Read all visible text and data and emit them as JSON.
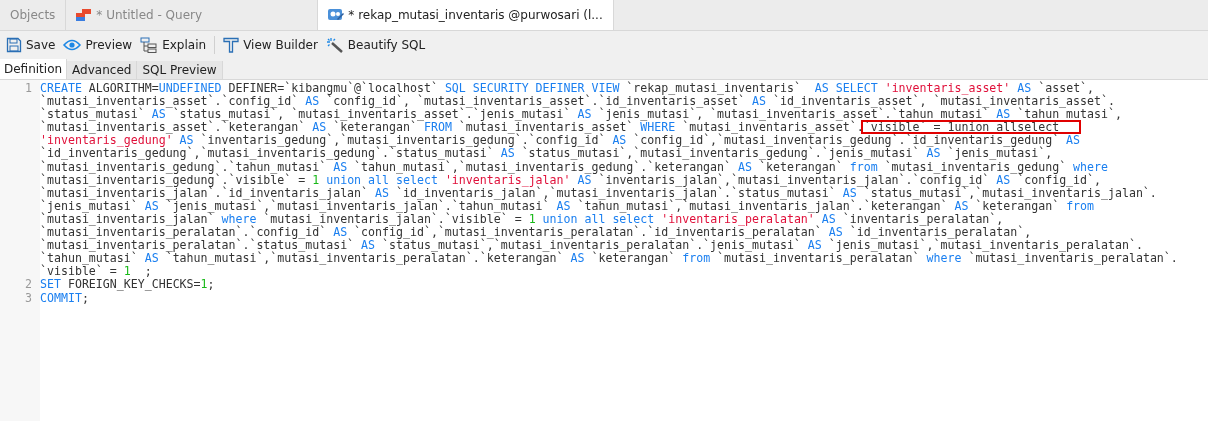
{
  "tabs": [
    {
      "label": "Objects",
      "kind": "plain",
      "selected": false
    },
    {
      "label": "* Untitled - Query",
      "kind": "query",
      "selected": false
    },
    {
      "label": "* rekap_mutasi_inventaris @purwosari (l...",
      "kind": "view",
      "selected": true
    }
  ],
  "toolbar": [
    {
      "label": "Save",
      "kind": "save"
    },
    {
      "label": "Preview",
      "kind": "preview"
    },
    {
      "label": "Explain",
      "kind": "explain",
      "separator_after": true
    },
    {
      "label": "View Builder",
      "kind": "builder"
    },
    {
      "label": "Beautify SQL",
      "kind": "beautify"
    }
  ],
  "subtabs": [
    {
      "label": "Definition",
      "selected": true
    },
    {
      "label": "Advanced",
      "selected": false
    },
    {
      "label": "SQL Preview",
      "selected": false
    }
  ],
  "editor": {
    "lines": [
      {
        "number": "1",
        "rows": [
          {
            "tokens": [
              {
                "kind": "kw",
                "text": "CREATE"
              },
              {
                "kind": "plain",
                "text": " ALGORITHM="
              },
              {
                "kind": "kw",
                "text": "UNDEFINED"
              },
              {
                "kind": "plain",
                "text": " DEFINER=`kibangmu`@`localhost` "
              },
              {
                "kind": "kw",
                "text": "SQL SECURITY DEFINER VIEW"
              },
              {
                "kind": "plain",
                "text": " `rekap_mutasi_inventaris`  "
              },
              {
                "kind": "kw",
                "text": "AS SELECT "
              },
              {
                "kind": "str",
                "text": "'inventaris_asset' "
              },
              {
                "kind": "kw",
                "text": "AS"
              },
              {
                "kind": "plain",
                "text": " `asset`,"
              }
            ]
          },
          {
            "tokens": [
              {
                "kind": "plain",
                "text": "`mutasi_inventaris_asset`.`config_id` "
              },
              {
                "kind": "kw",
                "text": "AS"
              },
              {
                "kind": "plain",
                "text": " `config_id`, `mutasi_inventaris_asset`.`id_inventaris_asset` "
              },
              {
                "kind": "kw",
                "text": "AS"
              },
              {
                "kind": "plain",
                "text": " `id_inventaris_asset`, `mutasi_inventaris_asset`."
              }
            ]
          },
          {
            "tokens": [
              {
                "kind": "plain",
                "text": "`status_mutasi` "
              },
              {
                "kind": "kw",
                "text": "AS"
              },
              {
                "kind": "plain",
                "text": " `status_mutasi`, `mutasi_inventaris_asset`.`jenis_mutasi` "
              },
              {
                "kind": "kw",
                "text": "AS"
              },
              {
                "kind": "plain",
                "text": " `jenis_mutasi`, `mutasi_inventaris_asset`.`tahun_mutasi` "
              },
              {
                "kind": "kw",
                "text": "AS"
              },
              {
                "kind": "plain",
                "text": " `tahun_mutasi`,"
              }
            ]
          },
          {
            "tokens": [
              {
                "kind": "plain",
                "text": "`mutasi_inventaris_asset`.`keterangan` "
              },
              {
                "kind": "kw",
                "text": "AS"
              },
              {
                "kind": "plain",
                "text": " `keterangan` "
              },
              {
                "kind": "kw",
                "text": "FROM"
              },
              {
                "kind": "plain",
                "text": " `mutasi_inventaris_asset` "
              },
              {
                "kind": "kw",
                "text": "WHERE"
              },
              {
                "kind": "plain",
                "text": " `mutasi_inventaris_asset`."
              },
              {
                "kind": "plain",
                "text": "`visible` = 1union allselect",
                "boxed": true
              }
            ]
          },
          {
            "tokens": [
              {
                "kind": "str",
                "text": "'inventaris_gedung' "
              },
              {
                "kind": "kw",
                "text": "AS"
              },
              {
                "kind": "plain",
                "text": " `inventaris_gedung`,`mutasi_inventaris_gedung`.`config_id` "
              },
              {
                "kind": "kw",
                "text": "AS"
              },
              {
                "kind": "plain",
                "text": " `config_id`,`mutasi_inventaris_gedung`.`id_inventaris_gedung` "
              },
              {
                "kind": "kw",
                "text": "AS"
              }
            ]
          },
          {
            "tokens": [
              {
                "kind": "plain",
                "text": "`id_inventaris_gedung`,`mutasi_inventaris_gedung`.`status_mutasi` "
              },
              {
                "kind": "kw",
                "text": "AS"
              },
              {
                "kind": "plain",
                "text": " `status_mutasi`,`mutasi_inventaris_gedung`.`jenis_mutasi` "
              },
              {
                "kind": "kw",
                "text": "AS"
              },
              {
                "kind": "plain",
                "text": " `jenis_mutasi`,"
              }
            ]
          },
          {
            "tokens": [
              {
                "kind": "plain",
                "text": "`mutasi_inventaris_gedung`.`tahun_mutasi` "
              },
              {
                "kind": "kw",
                "text": "AS"
              },
              {
                "kind": "plain",
                "text": " `tahun_mutasi`,`mutasi_inventaris_gedung`.`keterangan` "
              },
              {
                "kind": "kw",
                "text": "AS"
              },
              {
                "kind": "plain",
                "text": " `keterangan` "
              },
              {
                "kind": "kw",
                "text": "from"
              },
              {
                "kind": "plain",
                "text": " `mutasi_inventaris_gedung` "
              },
              {
                "kind": "kw",
                "text": "where"
              }
            ]
          },
          {
            "tokens": [
              {
                "kind": "plain",
                "text": "`mutasi_inventaris_gedung`.`visible` = "
              },
              {
                "kind": "num",
                "text": "1 "
              },
              {
                "kind": "kw",
                "text": "union all select "
              },
              {
                "kind": "str",
                "text": "'inventaris_jalan' "
              },
              {
                "kind": "kw",
                "text": "AS"
              },
              {
                "kind": "plain",
                "text": " `inventaris_jalan`,`mutasi_inventaris_jalan`.`config_id` "
              },
              {
                "kind": "kw",
                "text": "AS"
              },
              {
                "kind": "plain",
                "text": " `config_id`,"
              }
            ]
          },
          {
            "tokens": [
              {
                "kind": "plain",
                "text": "`mutasi_inventaris_jalan`.`id_inventaris_jalan` "
              },
              {
                "kind": "kw",
                "text": "AS"
              },
              {
                "kind": "plain",
                "text": " `id_inventaris_jalan`,`mutasi_inventaris_jalan`.`status_mutasi` "
              },
              {
                "kind": "kw",
                "text": "AS"
              },
              {
                "kind": "plain",
                "text": " `status_mutasi`,`mutasi_inventaris_jalan`."
              }
            ]
          },
          {
            "tokens": [
              {
                "kind": "plain",
                "text": "`jenis_mutasi` "
              },
              {
                "kind": "kw",
                "text": "AS"
              },
              {
                "kind": "plain",
                "text": " `jenis_mutasi`,`mutasi_inventaris_jalan`.`tahun_mutasi` "
              },
              {
                "kind": "kw",
                "text": "AS"
              },
              {
                "kind": "plain",
                "text": " `tahun_mutasi`,`mutasi_inventaris_jalan`.`keterangan` "
              },
              {
                "kind": "kw",
                "text": "AS"
              },
              {
                "kind": "plain",
                "text": " `keterangan` "
              },
              {
                "kind": "kw",
                "text": "from"
              }
            ]
          },
          {
            "tokens": [
              {
                "kind": "plain",
                "text": "`mutasi_inventaris_jalan` "
              },
              {
                "kind": "kw",
                "text": "where"
              },
              {
                "kind": "plain",
                "text": " `mutasi_inventaris_jalan`.`visible` = "
              },
              {
                "kind": "num",
                "text": "1 "
              },
              {
                "kind": "kw",
                "text": "union all select "
              },
              {
                "kind": "str",
                "text": "'inventaris_peralatan' "
              },
              {
                "kind": "kw",
                "text": "AS"
              },
              {
                "kind": "plain",
                "text": " `inventaris_peralatan`,"
              }
            ]
          },
          {
            "tokens": [
              {
                "kind": "plain",
                "text": "`mutasi_inventaris_peralatan`.`config_id` "
              },
              {
                "kind": "kw",
                "text": "AS"
              },
              {
                "kind": "plain",
                "text": " `config_id`,`mutasi_inventaris_peralatan`.`id_inventaris_peralatan` "
              },
              {
                "kind": "kw",
                "text": "AS"
              },
              {
                "kind": "plain",
                "text": " `id_inventaris_peralatan`,"
              }
            ]
          },
          {
            "tokens": [
              {
                "kind": "plain",
                "text": "`mutasi_inventaris_peralatan`.`status_mutasi` "
              },
              {
                "kind": "kw",
                "text": "AS"
              },
              {
                "kind": "plain",
                "text": " `status_mutasi`,`mutasi_inventaris_peralatan`.`jenis_mutasi` "
              },
              {
                "kind": "kw",
                "text": "AS"
              },
              {
                "kind": "plain",
                "text": " `jenis_mutasi`,`mutasi_inventaris_peralatan`."
              }
            ]
          },
          {
            "tokens": [
              {
                "kind": "plain",
                "text": "`tahun_mutasi` "
              },
              {
                "kind": "kw",
                "text": "AS"
              },
              {
                "kind": "plain",
                "text": " `tahun_mutasi`,`mutasi_inventaris_peralatan`.`keterangan` "
              },
              {
                "kind": "kw",
                "text": "AS"
              },
              {
                "kind": "plain",
                "text": " `keterangan` "
              },
              {
                "kind": "kw",
                "text": "from"
              },
              {
                "kind": "plain",
                "text": " `mutasi_inventaris_peralatan` "
              },
              {
                "kind": "kw",
                "text": "where"
              },
              {
                "kind": "plain",
                "text": " `mutasi_inventaris_peralatan`."
              }
            ]
          },
          {
            "tokens": [
              {
                "kind": "plain",
                "text": "`visible` = "
              },
              {
                "kind": "num",
                "text": "1"
              },
              {
                "kind": "plain",
                "text": "  ;"
              }
            ]
          }
        ]
      },
      {
        "number": "2",
        "rows": [
          {
            "tokens": [
              {
                "kind": "kw",
                "text": "SET"
              },
              {
                "kind": "plain",
                "text": " FOREIGN_KEY_CHECKS="
              },
              {
                "kind": "num",
                "text": "1"
              },
              {
                "kind": "plain",
                "text": ";"
              }
            ]
          }
        ]
      },
      {
        "number": "3",
        "rows": [
          {
            "tokens": [
              {
                "kind": "kw",
                "text": "COMMIT"
              },
              {
                "kind": "plain",
                "text": ";"
              }
            ]
          }
        ]
      }
    ]
  }
}
